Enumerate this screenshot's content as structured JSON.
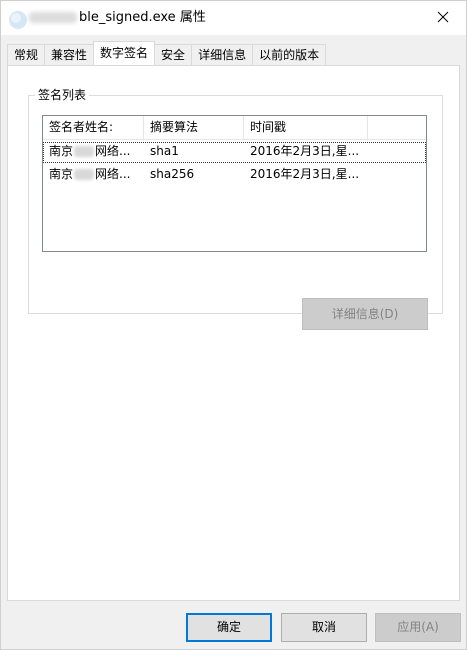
{
  "window": {
    "title": "ble_signed.exe 属性"
  },
  "tabs": [
    {
      "label": "常规",
      "active": false
    },
    {
      "label": "兼容性",
      "active": false
    },
    {
      "label": "数字签名",
      "active": true
    },
    {
      "label": "安全",
      "active": false
    },
    {
      "label": "详细信息",
      "active": false
    },
    {
      "label": "以前的版本",
      "active": false
    }
  ],
  "signature_list": {
    "group_label": "签名列表",
    "columns": [
      "签名者姓名:",
      "摘要算法",
      "时间戳"
    ],
    "rows": [
      {
        "name_prefix": "南京",
        "name_suffix": "网络...",
        "algorithm": "sha1",
        "timestamp": "2016年2月3日,星..."
      },
      {
        "name_prefix": "南京",
        "name_suffix": "网络...",
        "algorithm": "sha256",
        "timestamp": "2016年2月3日,星..."
      }
    ],
    "details_button": "详细信息(D)"
  },
  "footer": {
    "ok": "确定",
    "cancel": "取消",
    "apply": "应用(A)"
  },
  "colors": {
    "accent": "#0078d7",
    "window_bg": "#f0f0f0",
    "panel_bg": "#ffffff"
  }
}
